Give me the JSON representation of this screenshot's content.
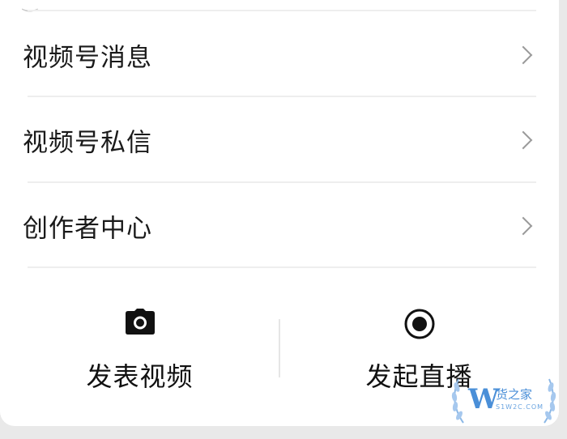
{
  "menu": {
    "items": [
      {
        "label": "视频号消息"
      },
      {
        "label": "视频号私信"
      },
      {
        "label": "创作者中心"
      }
    ]
  },
  "actions": {
    "post_video": {
      "label": "发表视频",
      "icon": "camera-icon"
    },
    "start_live": {
      "label": "发起直播",
      "icon": "live-record-icon"
    }
  },
  "watermark": {
    "brand": "货之家",
    "domain": "S1W2C.COM"
  },
  "colors": {
    "background": "#e9e9e9",
    "card": "#ffffff",
    "text": "#1a1a1a",
    "chevron": "#9a9a9a",
    "watermark": "#4a8fd8"
  }
}
